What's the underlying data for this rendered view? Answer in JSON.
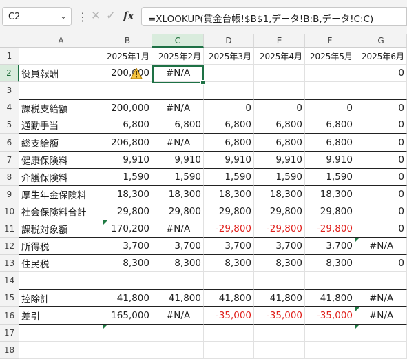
{
  "name_box": "C2",
  "formula": "=XLOOKUP(賃金台帳!$B$1,データ!B:B,データ!C:C)",
  "icons": {
    "cancel": "x-icon",
    "enter": "check-icon",
    "function": "fx-icon",
    "warning": "warning-triangle-icon"
  },
  "fx_label": "fx",
  "columns": [
    "A",
    "B",
    "C",
    "D",
    "E",
    "F",
    "G"
  ],
  "rows": [
    "1",
    "2",
    "3",
    "4",
    "5",
    "6",
    "7",
    "8",
    "9",
    "10",
    "11",
    "12",
    "13",
    "14",
    "15",
    "16",
    "17",
    "18"
  ],
  "header_row": [
    "",
    "2025年1月",
    "2025年2月",
    "2025年3月",
    "2025年4月",
    "2025年5月",
    "2025年6月"
  ],
  "grid": [
    [
      "役員報酬",
      "200,000",
      "#N/A",
      "",
      "",
      "",
      "0"
    ],
    [
      "",
      "",
      "",
      "",
      "",
      "",
      ""
    ],
    [
      "課税支給額",
      "200,000",
      "#N/A",
      "0",
      "0",
      "0",
      "0"
    ],
    [
      "通勤手当",
      "6,800",
      "6,800",
      "6,800",
      "6,800",
      "6,800",
      "0"
    ],
    [
      "総支給額",
      "206,800",
      "#N/A",
      "6,800",
      "6,800",
      "6,800",
      "0"
    ],
    [
      "健康保険料",
      "9,910",
      "9,910",
      "9,910",
      "9,910",
      "9,910",
      "0"
    ],
    [
      "介護保険料",
      "1,590",
      "1,590",
      "1,590",
      "1,590",
      "1,590",
      "0"
    ],
    [
      "厚生年金保険料",
      "18,300",
      "18,300",
      "18,300",
      "18,300",
      "18,300",
      "0"
    ],
    [
      "社会保険料合計",
      "29,800",
      "29,800",
      "29,800",
      "29,800",
      "29,800",
      "0"
    ],
    [
      "課税対象額",
      "170,200",
      "#N/A",
      "-29,800",
      "-29,800",
      "-29,800",
      "0"
    ],
    [
      "所得税",
      "3,700",
      "3,700",
      "3,700",
      "3,700",
      "3,700",
      "#N/A"
    ],
    [
      "住民税",
      "8,300",
      "8,300",
      "8,300",
      "8,300",
      "8,300",
      "0"
    ],
    [
      "",
      "",
      "",
      "",
      "",
      "",
      ""
    ],
    [
      "控除計",
      "41,800",
      "41,800",
      "41,800",
      "41,800",
      "41,800",
      "#N/A"
    ],
    [
      "差引",
      "165,000",
      "#N/A",
      "-35,000",
      "-35,000",
      "-35,000",
      "#N/A"
    ],
    [
      "",
      "",
      "",
      "",
      "",
      "",
      ""
    ],
    [
      "",
      "",
      "",
      "",
      "",
      "",
      ""
    ]
  ],
  "colors": {
    "selection": "#1e7145",
    "negative": "#e0201c",
    "header_bg": "#f3f3f3",
    "error_indicator": "#1f7a43"
  }
}
